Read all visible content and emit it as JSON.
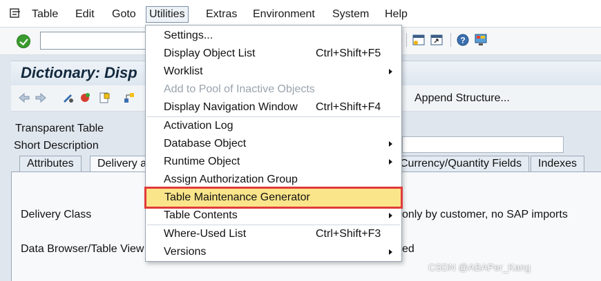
{
  "menubar": {
    "items": [
      "Table",
      "Edit",
      "Goto",
      "Utilities",
      "Extras",
      "Environment",
      "System",
      "Help"
    ],
    "active": "Utilities"
  },
  "screen": {
    "title": "Dictionary: Disp",
    "append_structure": "Append Structure...",
    "fields": {
      "transparent_table_label": "Transparent Table",
      "short_description_label": "Short Description",
      "delivery_class_label": "Delivery Class",
      "data_browser_label": "Data Browser/Table View",
      "delivery_class_value": "only by customer, no SAP imports",
      "data_browser_value": "ed"
    },
    "tabs": [
      "Attributes",
      "Delivery a",
      "Currency/Quantity Fields",
      "Indexes"
    ]
  },
  "utilities_menu": {
    "items": [
      {
        "label": "Settings...",
        "shortcut": "",
        "submenu": false,
        "disabled": false
      },
      {
        "label": "Display Object List",
        "shortcut": "Ctrl+Shift+F5",
        "submenu": false,
        "disabled": false
      },
      {
        "label": "Worklist",
        "shortcut": "",
        "submenu": true,
        "disabled": false
      },
      {
        "label": "Add to Pool of Inactive Objects",
        "shortcut": "",
        "submenu": false,
        "disabled": true
      },
      {
        "label": "Display Navigation Window",
        "shortcut": "Ctrl+Shift+F4",
        "submenu": false,
        "disabled": false
      },
      {
        "label": "Activation Log",
        "shortcut": "",
        "submenu": false,
        "disabled": false
      },
      {
        "label": "Database Object",
        "shortcut": "",
        "submenu": true,
        "disabled": false
      },
      {
        "label": "Runtime Object",
        "shortcut": "",
        "submenu": true,
        "disabled": false
      },
      {
        "label": "Assign Authorization Group",
        "shortcut": "",
        "submenu": false,
        "disabled": false
      },
      {
        "label": "Table Maintenance Generator",
        "shortcut": "",
        "submenu": false,
        "disabled": false,
        "highlighted": true
      },
      {
        "label": "Table Contents",
        "shortcut": "",
        "submenu": true,
        "disabled": false
      },
      {
        "label": "Where-Used List",
        "shortcut": "Ctrl+Shift+F3",
        "submenu": false,
        "disabled": false
      },
      {
        "label": "Versions",
        "shortcut": "",
        "submenu": true,
        "disabled": false
      }
    ]
  },
  "watermark": "CSDN @ABAPer_Kang",
  "colors": {
    "highlight_fill": "#fbe58a",
    "highlight_border": "#e03a3a",
    "ok_green": "#3a9b2e"
  }
}
